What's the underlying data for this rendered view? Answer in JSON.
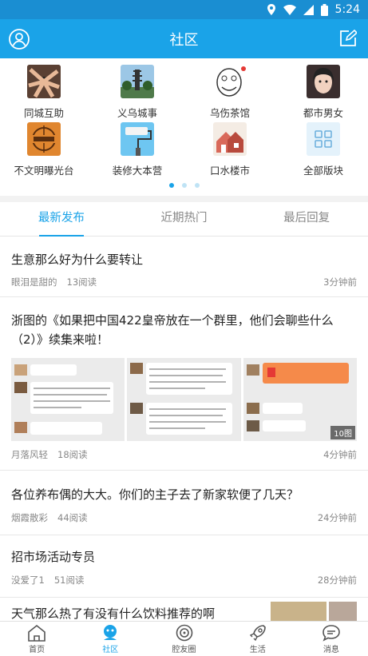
{
  "status": {
    "time": "5:24"
  },
  "header": {
    "title": "社区"
  },
  "categories": [
    {
      "label": "同城互助",
      "icon": "hands-icon"
    },
    {
      "label": "义乌城事",
      "icon": "city-tower-icon"
    },
    {
      "label": "乌伤茶馆",
      "icon": "face-meme-icon"
    },
    {
      "label": "都市男女",
      "icon": "girl-photo-icon"
    },
    {
      "label": "不文明曝光台",
      "icon": "exposure-icon"
    },
    {
      "label": "装修大本营",
      "icon": "paint-roller-icon"
    },
    {
      "label": "口水楼市",
      "icon": "houses-icon"
    },
    {
      "label": "全部版块",
      "icon": "grid-icon"
    }
  ],
  "tabs": [
    {
      "label": "最新发布",
      "active": true
    },
    {
      "label": "近期热门",
      "active": false
    },
    {
      "label": "最后回复",
      "active": false
    }
  ],
  "posts": [
    {
      "title": "生意那么好为什么要转让",
      "author": "眼泪是甜的",
      "reads": "13阅读",
      "time": "3分钟前"
    },
    {
      "title": "浙图的《如果把中国422皇帝放在一个群里，他们会聊些什么（2）》续集来啦！",
      "author": "月落风轻",
      "reads": "18阅读",
      "time": "4分钟前",
      "image_count": "10图"
    },
    {
      "title": "各位养布偶的大大。你们的主子去了新家软便了几天？",
      "author": "烟霞散彩",
      "reads": "44阅读",
      "time": "24分钟前"
    },
    {
      "title": "招市场活动专员",
      "author": "没爱了1",
      "reads": "51阅读",
      "time": "28分钟前"
    },
    {
      "title": "天气那么热了有没有什么饮料推荐的啊"
    }
  ],
  "bottom_nav": [
    {
      "label": "首页",
      "icon": "home-icon",
      "active": false
    },
    {
      "label": "社区",
      "icon": "community-icon",
      "active": true
    },
    {
      "label": "腔友圈",
      "icon": "friends-circle-icon",
      "active": false
    },
    {
      "label": "生活",
      "icon": "rocket-icon",
      "active": false
    },
    {
      "label": "消息",
      "icon": "message-icon",
      "active": false
    }
  ],
  "colors": {
    "accent": "#1aa3e8",
    "statusbar": "#1a8ed2"
  }
}
